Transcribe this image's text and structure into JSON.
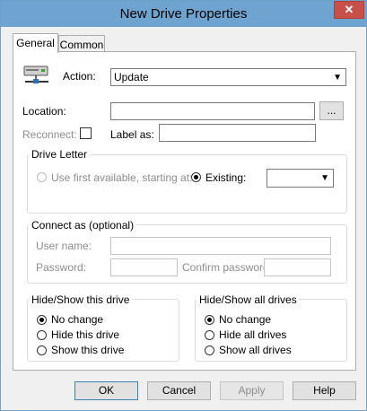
{
  "window": {
    "title": "New Drive Properties",
    "close_glyph": "✕"
  },
  "tabs": [
    {
      "label": "General"
    },
    {
      "label": "Common"
    }
  ],
  "general": {
    "action_label": "Action:",
    "action_value": "Update",
    "location_label": "Location:",
    "location_value": "",
    "browse_label": "...",
    "reconnect_label": "Reconnect:",
    "reconnect_checked": false,
    "label_as_label": "Label as:",
    "label_as_value": ""
  },
  "drive_letter": {
    "group_label": "Drive Letter",
    "first_available_label": "Use first available, starting at:",
    "existing_label": "Existing:",
    "existing_value": ""
  },
  "connect_as": {
    "group_label": "Connect as (optional)",
    "user_name_label": "User name:",
    "password_label": "Password:",
    "confirm_password_label": "Confirm password:"
  },
  "hide_show_this": {
    "group_label": "Hide/Show this drive",
    "options": [
      "No change",
      "Hide this drive",
      "Show this drive"
    ],
    "selected": "No change"
  },
  "hide_show_all": {
    "group_label": "Hide/Show all drives",
    "options": [
      "No change",
      "Hide all drives",
      "Show all drives"
    ],
    "selected": "No change"
  },
  "buttons": {
    "ok": "OK",
    "cancel": "Cancel",
    "apply": "Apply",
    "help": "Help"
  },
  "icons": {
    "drive": "network-drive-icon",
    "dropdown": "chevron-down-icon"
  },
  "colors": {
    "titlebar": "#6fa3d0",
    "close": "#c7504a",
    "default_button_border": "#3c7fb1"
  }
}
